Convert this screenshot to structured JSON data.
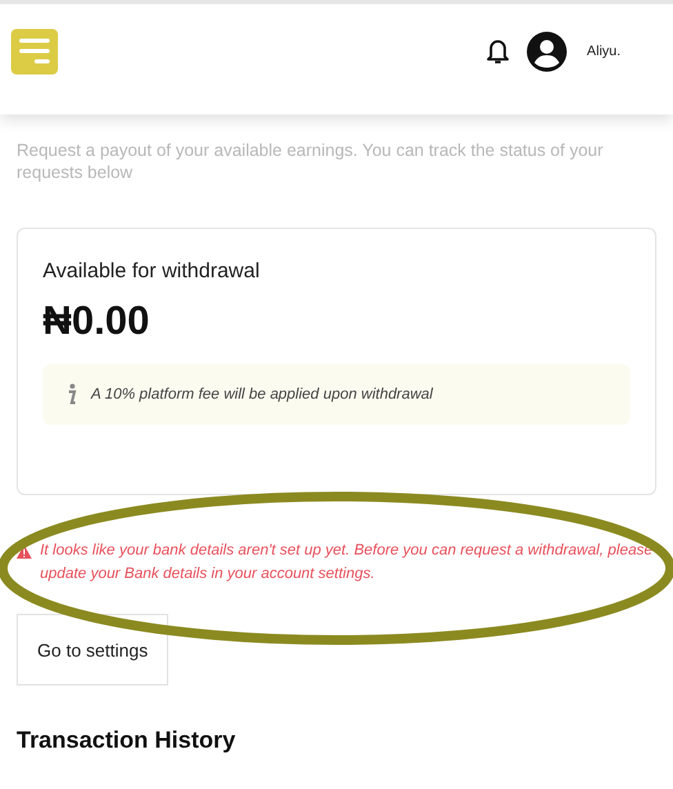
{
  "header": {
    "user_name": "Aliyu."
  },
  "intro": "Request a payout of your available earnings. You can track the status of your requests below",
  "balance_card": {
    "label": "Available for withdrawal",
    "amount": "₦0.00",
    "note": "A 10% platform fee will be applied upon withdrawal"
  },
  "alert": {
    "message": "It looks like your bank details aren't set up yet. Before you can request a withdrawal, please update your Bank details in your account settings."
  },
  "settings_button": "Go to settings",
  "section_title": "Transaction History"
}
